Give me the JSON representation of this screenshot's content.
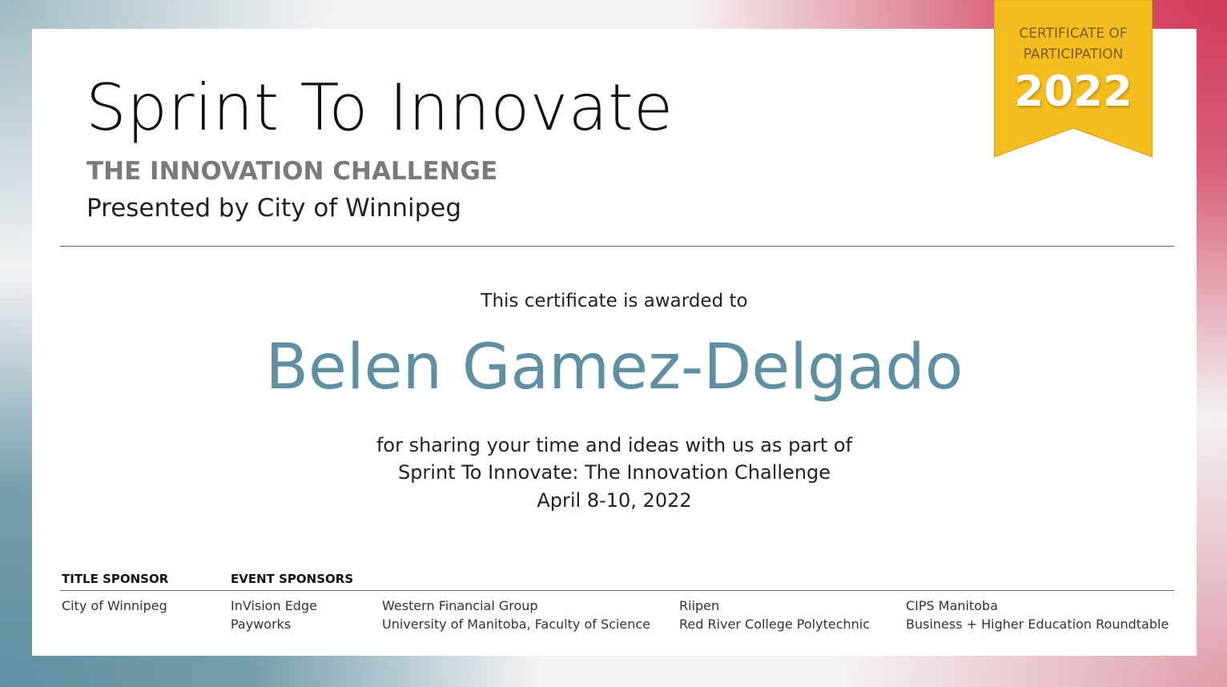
{
  "certificate": {
    "title": "Sprint To Innovate",
    "subtitle": "THE INNOVATION CHALLENGE",
    "presented_by": "Presented by City of Winnipeg",
    "awarded_text": "This certificate is awarded to",
    "recipient": "Belen Gamez-Delgado",
    "description": [
      "for sharing your time and ideas with us as part of",
      "Sprint To Innovate: The Innovation Challenge",
      "April 8-10, 2022"
    ]
  },
  "ribbon": {
    "line1": "CERTIFICATE OF",
    "line2": "PARTICIPATION",
    "year": "2022",
    "color": "#f5bd1f"
  },
  "sponsors": {
    "title_sponsor_heading": "TITLE SPONSOR",
    "event_sponsors_heading": "EVENT SPONSORS",
    "title_sponsor": "City of Winnipeg",
    "event_sponsors": [
      [
        "InVision Edge",
        "Payworks"
      ],
      [
        "Western Financial Group",
        "University of Manitoba, Faculty of Science"
      ],
      [
        "Riipen",
        "Red River College Polytechnic"
      ],
      [
        "CIPS Manitoba",
        "Business + Higher Education Roundtable"
      ]
    ]
  },
  "colors": {
    "accent_blue": "#5f8fa1",
    "accent_red": "#d13b5b"
  }
}
